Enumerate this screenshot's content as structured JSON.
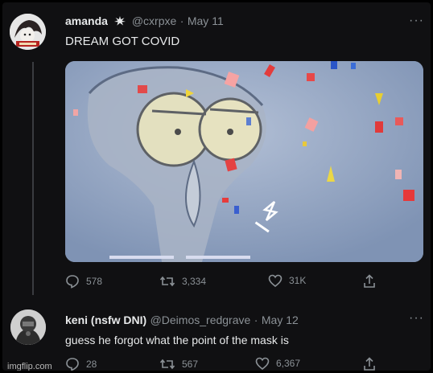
{
  "tweet1": {
    "display_name": "amanda",
    "handle": "@cxrpxe",
    "separator": "·",
    "date": "May 11",
    "text": "DREAM GOT COVID",
    "actions": {
      "replies": "578",
      "retweets": "3,334",
      "likes": "31K"
    }
  },
  "tweet2": {
    "display_name": "keni (nsfw DNI)",
    "handle": "@Deimos_redgrave",
    "separator": "·",
    "date": "May 12",
    "text": "guess he forgot what the point of the mask is",
    "actions": {
      "replies": "28",
      "retweets": "567",
      "likes": "6,367"
    }
  },
  "more_label": "···",
  "watermark": "imgflip.com",
  "colors": {
    "background": "#101012",
    "text": "#e7e9ea",
    "muted": "#8b9196",
    "media_bg": "#98a9c3"
  },
  "icons": [
    "reply-icon",
    "retweet-icon",
    "like-icon",
    "share-icon",
    "more-icon",
    "starburst-icon"
  ]
}
